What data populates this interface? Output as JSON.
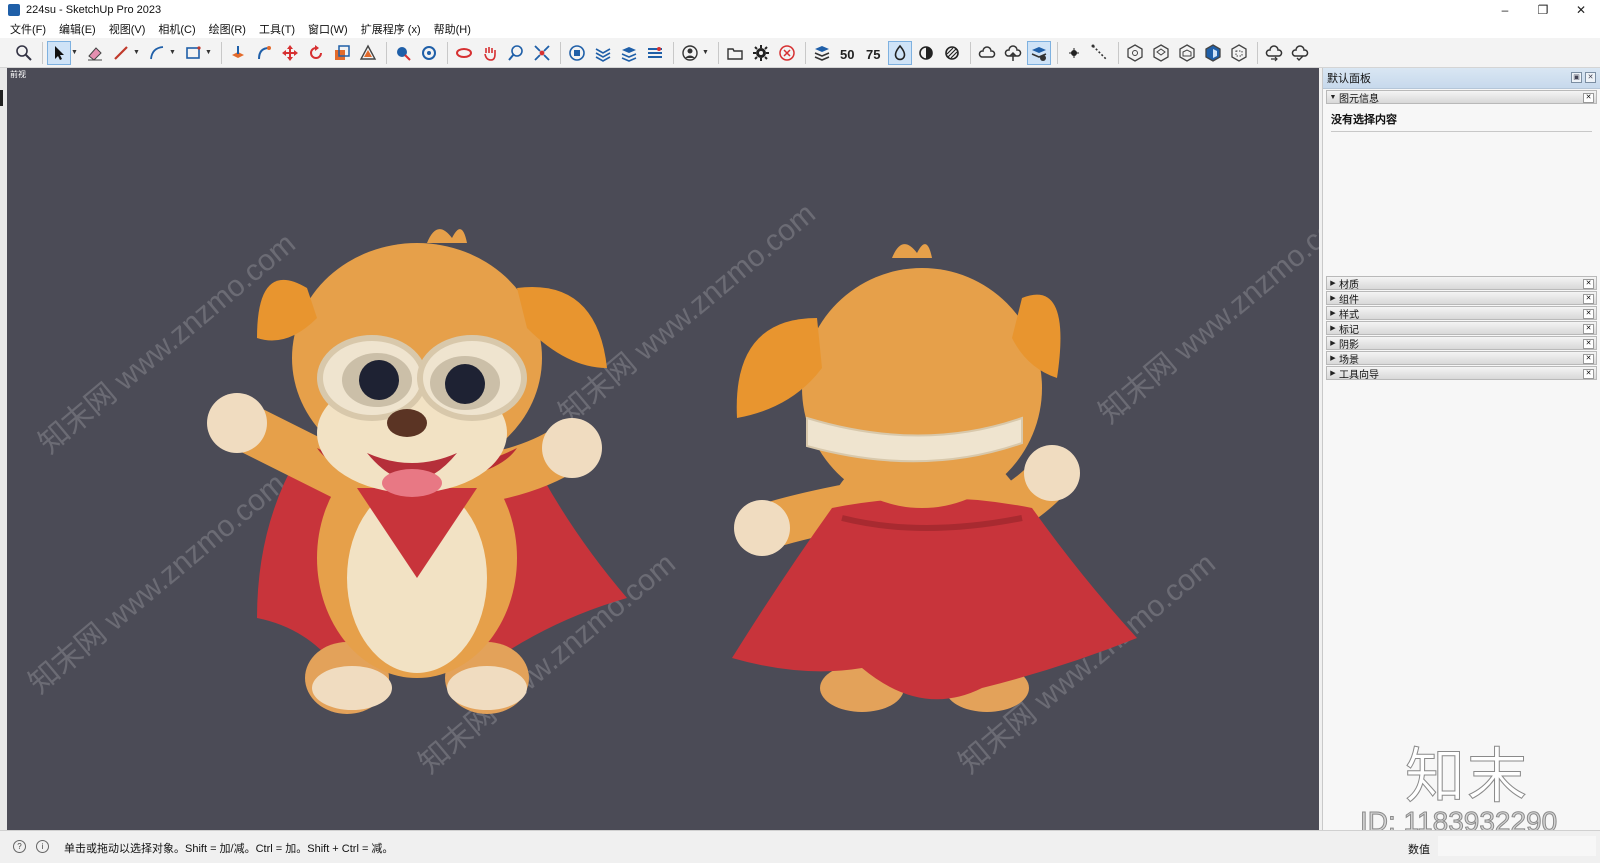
{
  "window": {
    "title": "224su - SketchUp Pro 2023",
    "controls": [
      "–",
      "❐",
      "✕"
    ]
  },
  "menu": [
    "文件(F)",
    "编辑(E)",
    "视图(V)",
    "相机(C)",
    "绘图(R)",
    "工具(T)",
    "窗口(W)",
    "扩展程序 (x)",
    "帮助(H)"
  ],
  "toolbar": {
    "groups": [
      [
        "zoom-extents-icon"
      ],
      [
        "select-icon",
        "eraser-icon",
        "pencil-line-icon",
        "arc-icon",
        "rectangle-icon"
      ],
      [
        "push-pull-icon",
        "follow-me-icon",
        "move-icon",
        "rotate-icon",
        "scale-icon",
        "offset-icon"
      ],
      [
        "tape-measure-icon",
        "paint-bucket-icon"
      ],
      [
        "orbit-icon",
        "pan-icon",
        "zoom-icon",
        "zoom-window-icon"
      ],
      [
        "warehouse-icon",
        "extension-manager-icon",
        "layout-icon",
        "send-to-icon"
      ],
      [
        "user-icon"
      ],
      [
        "open-folder-icon",
        "settings-icon",
        "stop-icon"
      ],
      [
        "model-info-icon",
        "fifty-icon",
        "seventyfive-icon",
        "xray-icon",
        "shaded-icon",
        "monochrome-icon"
      ],
      [
        "cloud-icon",
        "cloud-upload-icon",
        "cloud-shared-icon"
      ],
      [
        "point-icon",
        "dashed-line-icon"
      ],
      [
        "iso-view-icon",
        "top-view-icon",
        "front-view-icon",
        "right-view-icon",
        "back-view-icon"
      ],
      [
        "cloud-sync-icon",
        "cloud-check-icon"
      ]
    ]
  },
  "viewport": {
    "scene_label": "前视",
    "background": "#4b4b56",
    "watermark": "知末网 www.znzmo.com"
  },
  "panel": {
    "title": "默认面板",
    "entity_info": {
      "label": "图元信息",
      "content": "没有选择内容"
    },
    "trays": [
      "材质",
      "组件",
      "样式",
      "标记",
      "阴影",
      "场景",
      "工具向导"
    ]
  },
  "brand": {
    "logo": "知末",
    "id": "ID: 1183932290"
  },
  "status": {
    "hint": "单击或拖动以选择对象。Shift = 加/减。Ctrl = 加。Shift + Ctrl = 减。",
    "measure_label": "数值"
  },
  "colors": {
    "accent": "#1f5fa8",
    "cape": "#c8343b",
    "fur": "#e6a04a",
    "belly": "#f2e2c4"
  }
}
